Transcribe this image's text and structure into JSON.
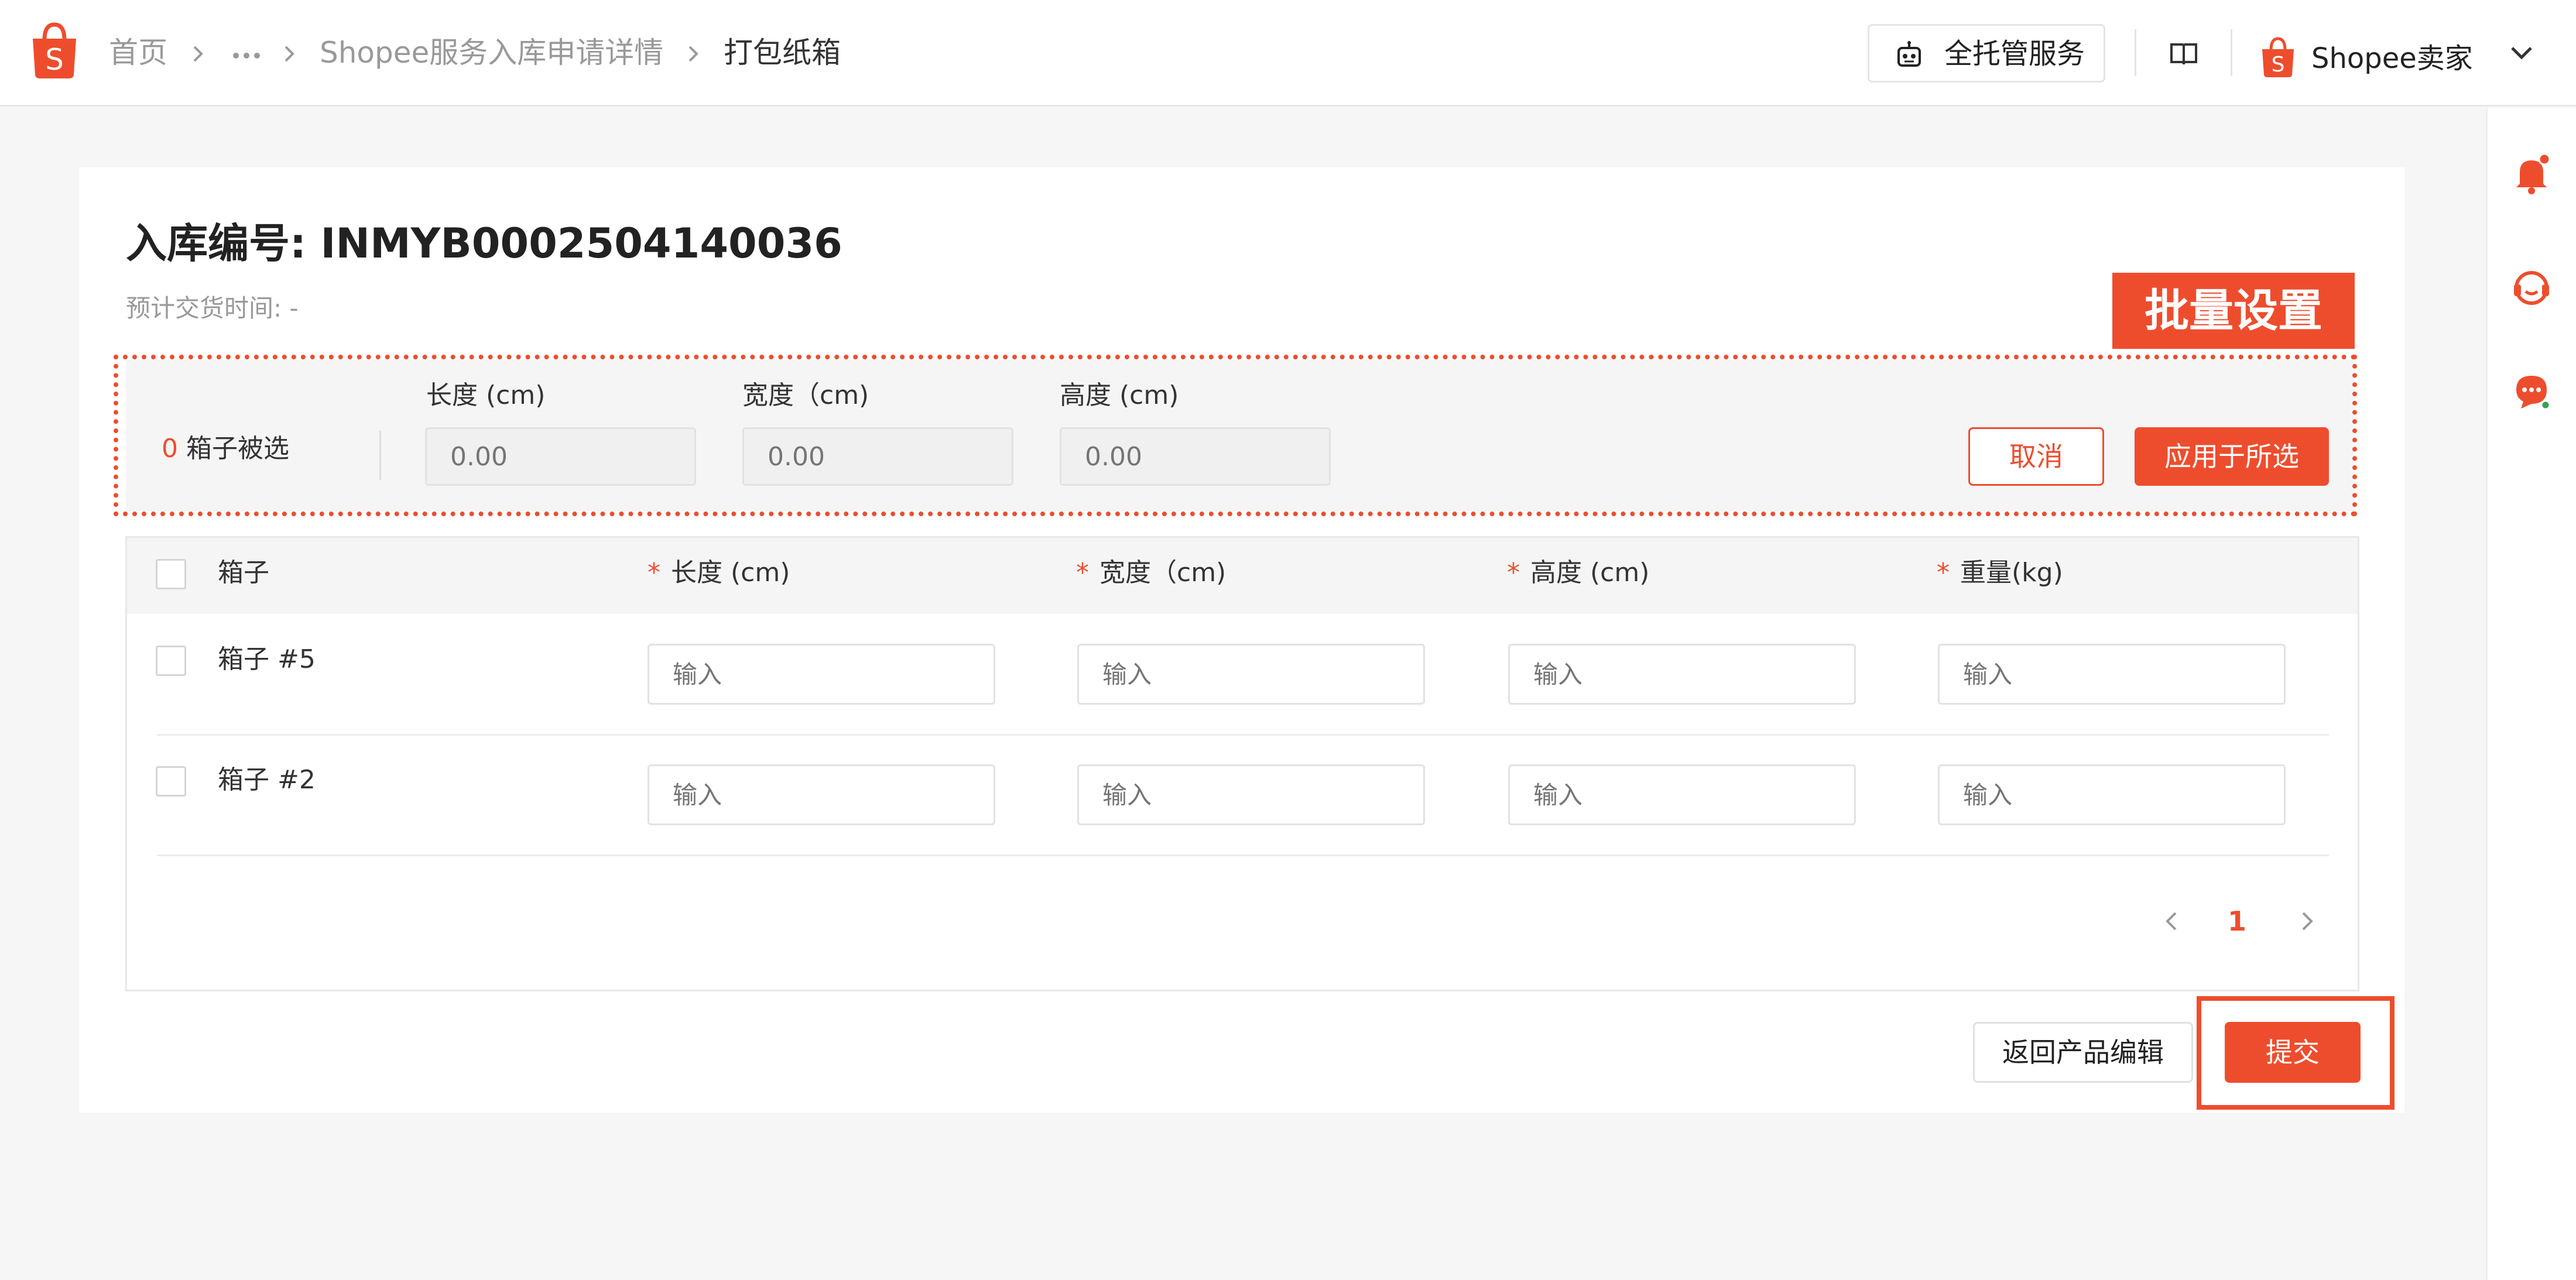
{
  "header": {
    "breadcrumbs": [
      "首页",
      "···",
      "Shopee服务入库申请详情",
      "打包纸箱"
    ],
    "service_button": "全托管服务",
    "seller_name": "Shopee卖家",
    "icons": [
      "shopee-bag-icon",
      "robot-icon",
      "book-icon",
      "chevron-down-icon"
    ]
  },
  "rail": {
    "icons": [
      "bell-icon",
      "headset-icon",
      "chat-icon"
    ],
    "notification_dot_color": "#ee4d2d"
  },
  "page": {
    "title": "入库编号: INMYB0002504140036",
    "subtitle": "预计交货时间: -"
  },
  "annotation": {
    "label": "批量设置",
    "color": "#ee4d2d"
  },
  "batch": {
    "selected_count": "0",
    "selected_suffix": " 箱子被选",
    "fields": [
      {
        "label": "长度 (cm)",
        "placeholder": "0.00"
      },
      {
        "label": "宽度（cm)",
        "placeholder": "0.00"
      },
      {
        "label": "高度 (cm)",
        "placeholder": "0.00"
      }
    ],
    "cancel": "取消",
    "apply": "应用于所选"
  },
  "table": {
    "columns": [
      {
        "label": "箱子",
        "required": false
      },
      {
        "label": "长度 (cm)",
        "required": true
      },
      {
        "label": "宽度（cm)",
        "required": true
      },
      {
        "label": "高度 (cm)",
        "required": true
      },
      {
        "label": "重量(kg)",
        "required": true
      }
    ],
    "required_mark": "*",
    "rows": [
      {
        "name": "箱子 #5",
        "placeholder": "输入"
      },
      {
        "name": "箱子 #2",
        "placeholder": "输入"
      }
    ],
    "pagination": {
      "current": "1"
    }
  },
  "footer": {
    "back": "返回产品编辑",
    "submit": "提交"
  },
  "colors": {
    "accent": "#ee4d2d",
    "background": "#f6f6f6"
  }
}
